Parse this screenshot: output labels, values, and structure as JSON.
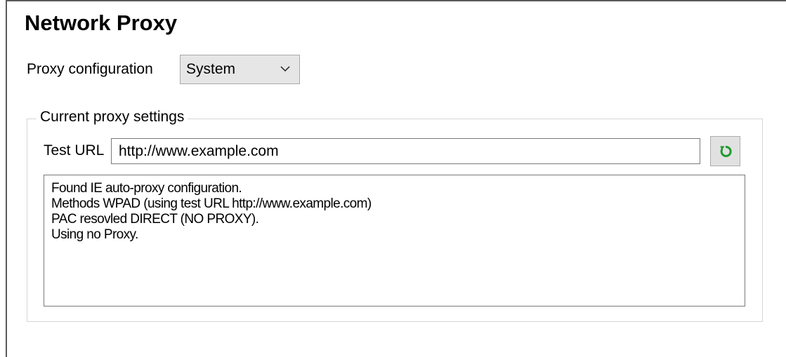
{
  "page": {
    "title": "Network Proxy"
  },
  "proxy_configuration": {
    "label": "Proxy configuration",
    "selected": "System"
  },
  "current_proxy_settings": {
    "legend": "Current proxy settings",
    "test_url_label": "Test URL",
    "test_url_value": "http://www.example.com",
    "refresh_icon": "refresh-icon",
    "refresh_icon_color": "#1e9b2e",
    "output_lines": [
      "Found IE auto-proxy configuration.",
      "Methods WPAD (using test URL http://www.example.com)",
      "PAC resovled DIRECT (NO PROXY).",
      "Using no Proxy."
    ]
  }
}
